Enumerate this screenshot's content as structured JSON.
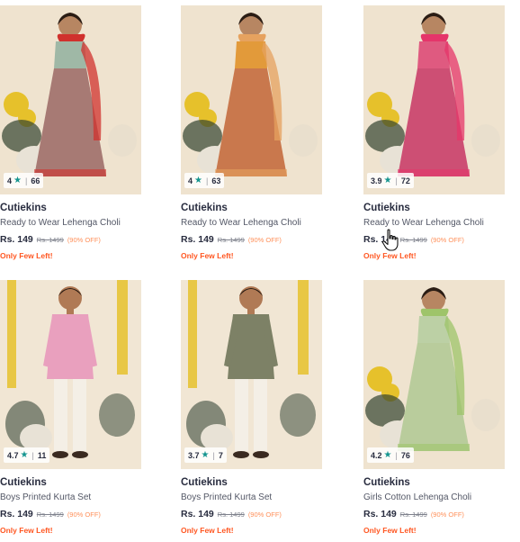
{
  "products": [
    {
      "brand": "Cutiekins",
      "title": "Ready to Wear Lehenga Choli",
      "price": "Rs. 149",
      "mrp": "Rs. 1499",
      "discount": "(90% OFF)",
      "stock": "Only Few Left!",
      "rating": "4",
      "count": "66",
      "colors": {
        "bg": "#efe3cf",
        "top": "#9fb8a6",
        "bottom": "#a77a74",
        "dupatta": "#d0312d"
      }
    },
    {
      "brand": "Cutiekins",
      "title": "Ready to Wear Lehenga Choli",
      "price": "Rs. 149",
      "mrp": "Rs. 1499",
      "discount": "(90% OFF)",
      "stock": "Only Few Left!",
      "rating": "4",
      "count": "63",
      "colors": {
        "bg": "#efe3cf",
        "top": "#e29a3a",
        "bottom": "#c9784d",
        "dupatta": "#e6a25f"
      }
    },
    {
      "brand": "Cutiekins",
      "title": "Ready to Wear Lehenga Choli",
      "price": "Rs. 149",
      "mrp": "Rs. 1499",
      "discount": "(90% OFF)",
      "stock": "Only Few Left!",
      "rating": "3.9",
      "count": "72",
      "colors": {
        "bg": "#efe3cf",
        "top": "#df5a80",
        "bottom": "#cd4f74",
        "dupatta": "#e5356a"
      }
    },
    {
      "brand": "Cutiekins",
      "title": "Boys Printed Kurta Set",
      "price": "Rs. 149",
      "mrp": "Rs. 1499",
      "discount": "(90% OFF)",
      "stock": "Only Few Left!",
      "rating": "4.7",
      "count": "11",
      "colors": {
        "bg": "#f1e6d4",
        "top": "#e9a0be",
        "bottom": "#f4efe6",
        "dupatta": ""
      }
    },
    {
      "brand": "Cutiekins",
      "title": "Boys Printed Kurta Set",
      "price": "Rs. 149",
      "mrp": "Rs. 1499",
      "discount": "(90% OFF)",
      "stock": "Only Few Left!",
      "rating": "3.7",
      "count": "7",
      "colors": {
        "bg": "#f1e6d4",
        "top": "#7d8166",
        "bottom": "#f4efe6",
        "dupatta": ""
      }
    },
    {
      "brand": "Cutiekins",
      "title": "Girls Cotton Lehenga Choli",
      "price": "Rs. 149",
      "mrp": "Rs. 1499",
      "discount": "(90% OFF)",
      "stock": "Only Few Left!",
      "rating": "4.2",
      "count": "76",
      "colors": {
        "bg": "#efe3cf",
        "top": "#bcd0a5",
        "bottom": "#b9cc9c",
        "dupatta": "#9ec46a"
      }
    }
  ],
  "theme": {
    "star_color": "#14958f",
    "discount_color": "#ff905a",
    "stock_color": "#ff5722"
  }
}
